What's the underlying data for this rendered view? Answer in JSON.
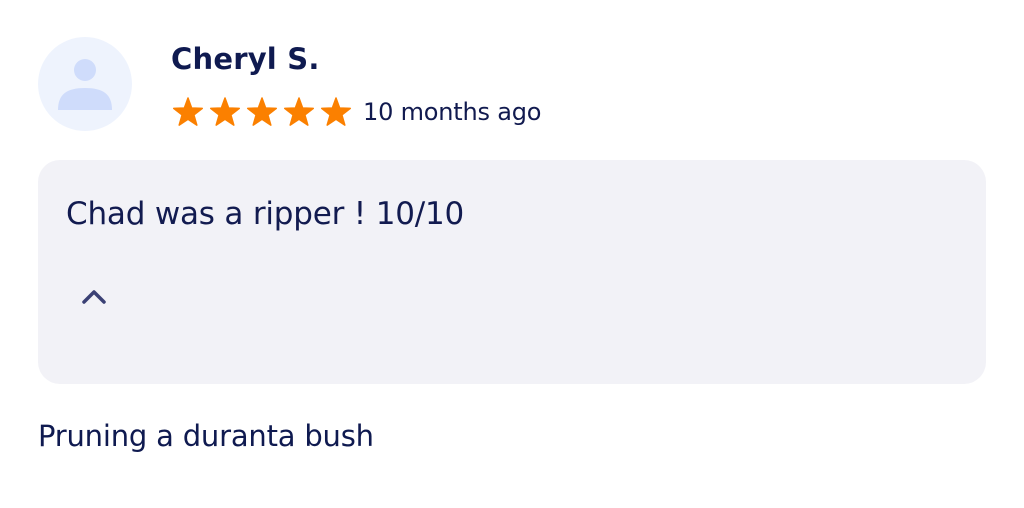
{
  "review": {
    "reviewer_name": "Cheryl S.",
    "rating": 5,
    "rating_max": 5,
    "date": "10 months ago",
    "text": "Chad was a ripper ! 10/10",
    "service_title": "Pruning a duranta bush"
  },
  "icons": {
    "avatar": "user-placeholder-icon",
    "star": "star-icon",
    "collapse": "chevron-up-icon"
  },
  "colors": {
    "star": "#fb8000",
    "text": "#111a4f",
    "avatar_bg": "#eef3fd",
    "avatar_fg": "#cfdcfb",
    "review_bg": "#f2f2f7",
    "chevron": "#3b4175"
  }
}
